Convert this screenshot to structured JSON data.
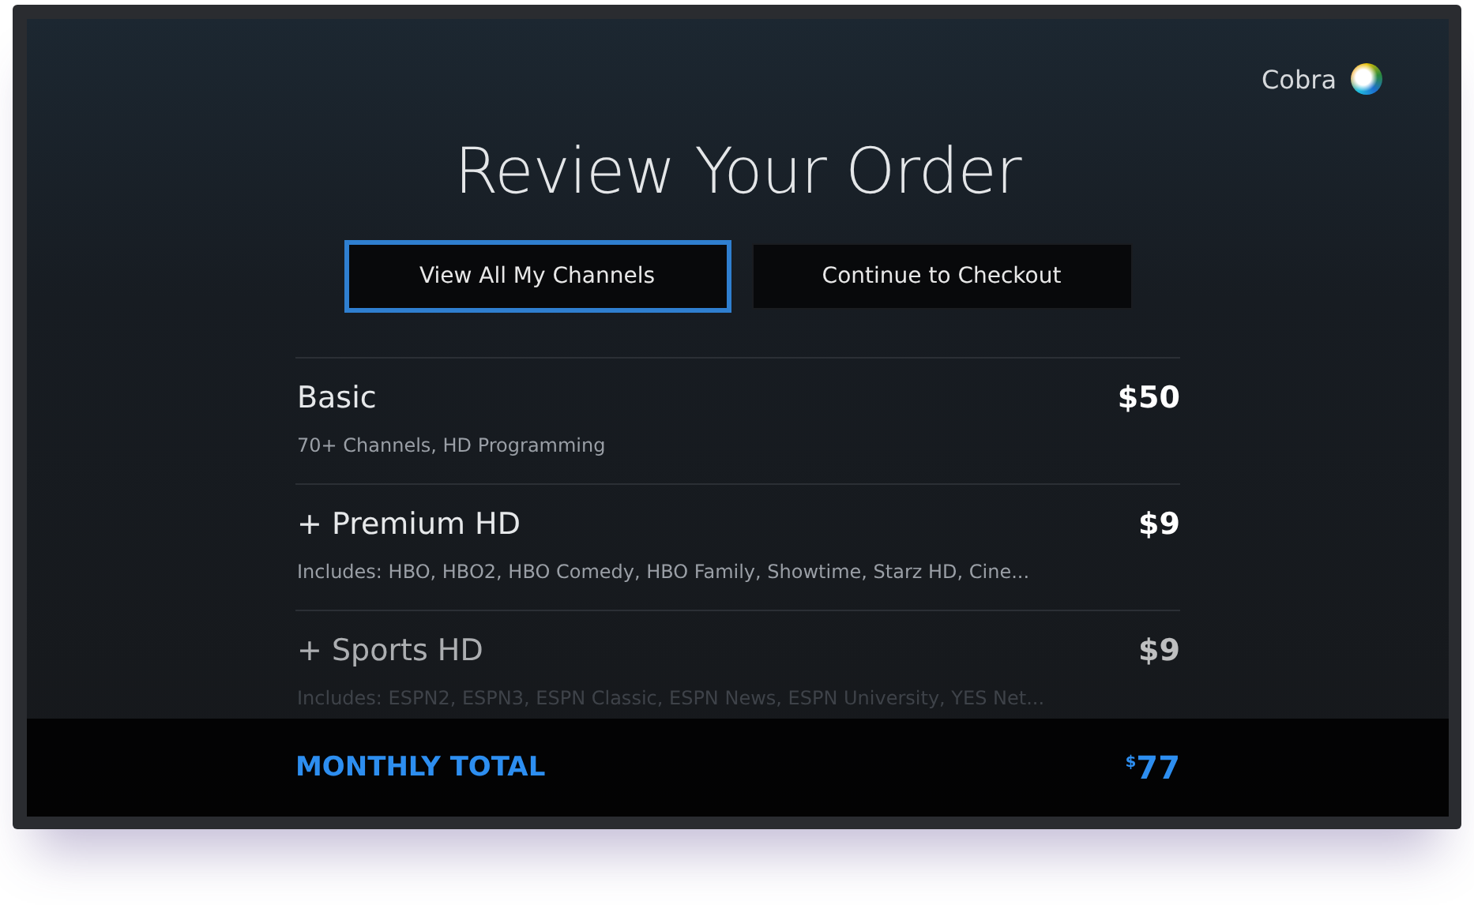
{
  "user": {
    "name": "Cobra"
  },
  "title": "Review Your Order",
  "buttons": [
    {
      "label": "View All My Channels",
      "selected": true
    },
    {
      "label": "Continue to Checkout",
      "selected": false
    }
  ],
  "items": [
    {
      "name": "Basic",
      "price": "$50",
      "description": "70+ Channels, HD Programming",
      "dimmed": false
    },
    {
      "name": "+ Premium HD",
      "price": "$9",
      "description": "Includes: HBO, HBO2, HBO Comedy, HBO Family, Showtime, Starz HD, Cine...",
      "dimmed": false
    },
    {
      "name": "+ Sports HD",
      "price": "$9",
      "description": "Includes: ESPN2, ESPN3, ESPN Classic, ESPN News, ESPN University, YES Net...",
      "dimmed": true
    }
  ],
  "total": {
    "label": "MONTHLY TOTAL",
    "currency": "$",
    "amount": "77"
  }
}
